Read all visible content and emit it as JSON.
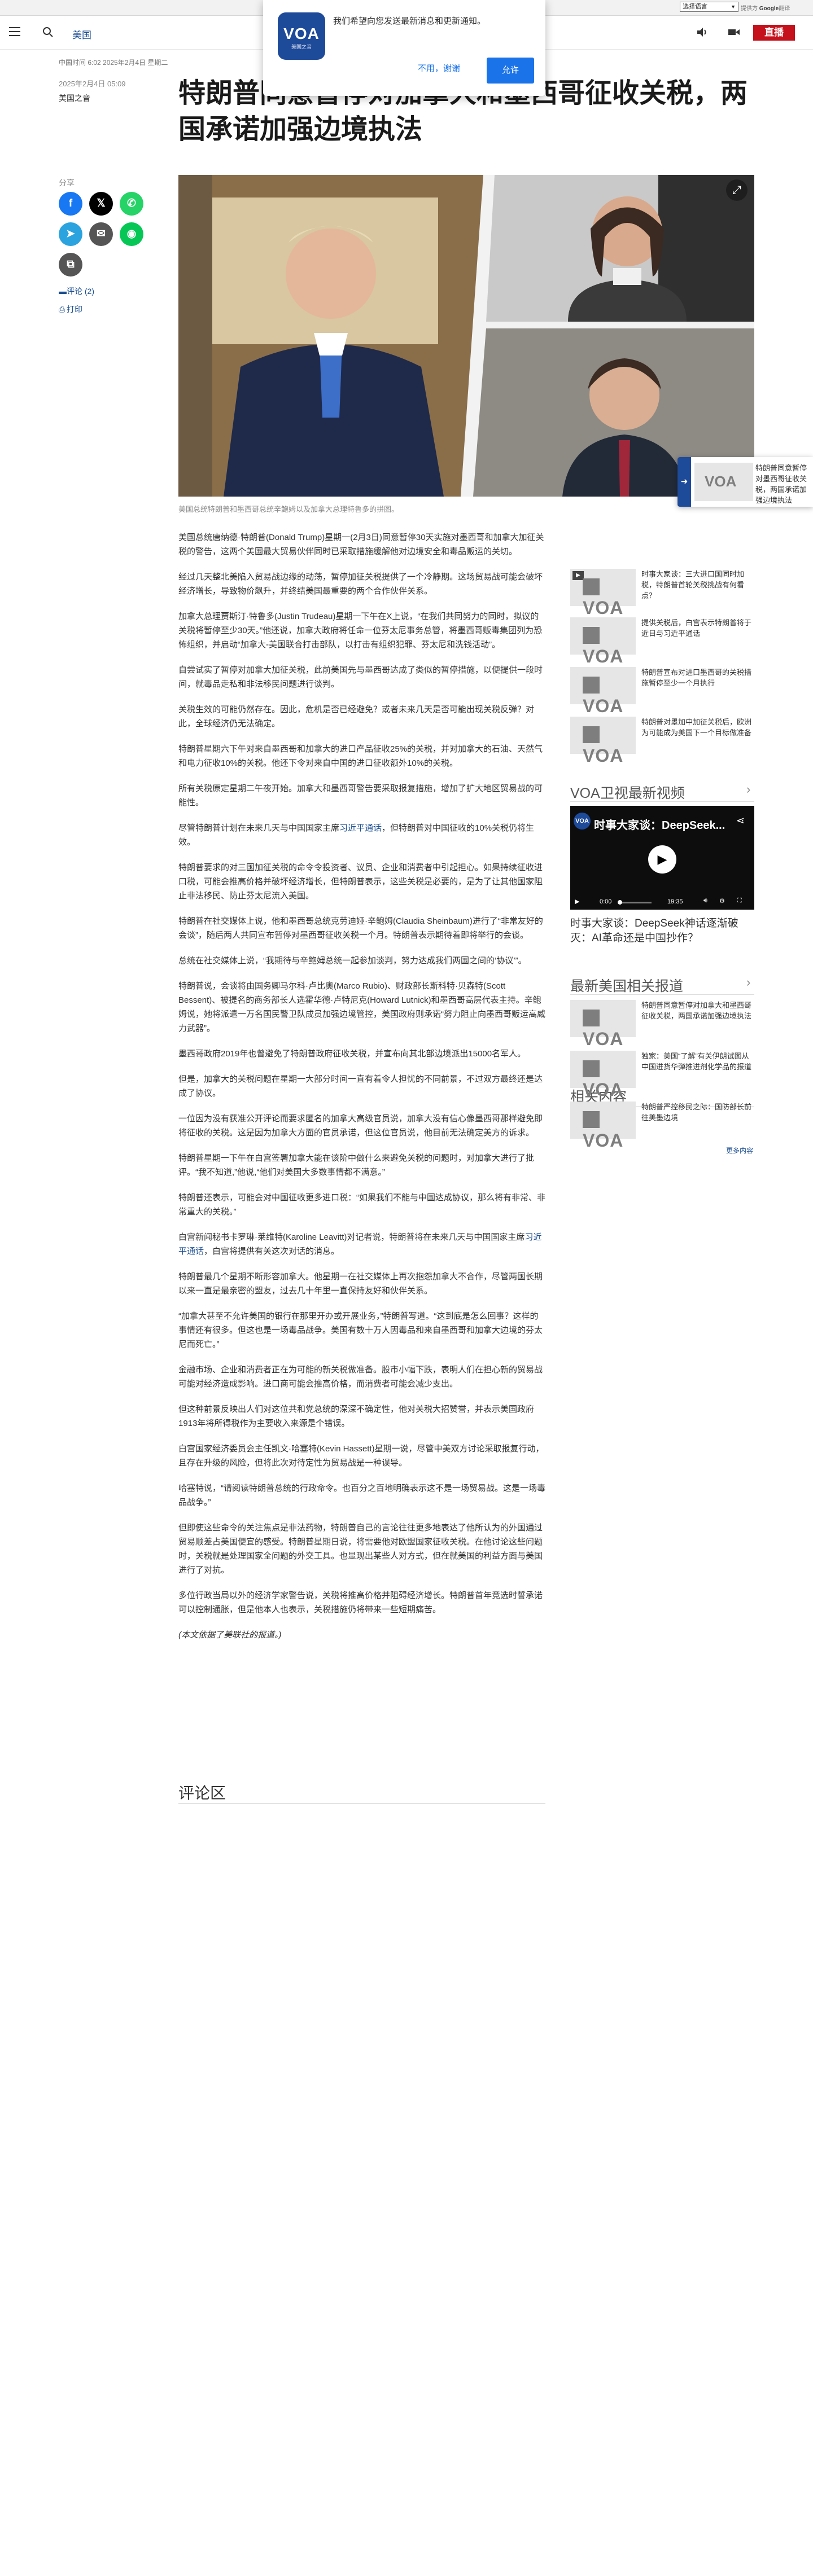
{
  "translate_bar": {
    "select_label": "选择语言",
    "powered_by_prefix": "提供方",
    "powered_by_brand": "Google",
    "powered_by_suffix": "翻译"
  },
  "header": {
    "section": "美国",
    "live_label": "直播"
  },
  "notification": {
    "logo_text": "VOA",
    "logo_sub": "美国之音",
    "message": "我们希望向您发送最新消息和更新通知。",
    "later_label": "不用，谢谢",
    "allow_label": "允许"
  },
  "meta": {
    "updated": "中国时间 6:02 2025年2月4日 星期二",
    "date": "2025年2月4日 05:09",
    "author": "美国之音"
  },
  "title": "特朗普同意暂停对加拿大和墨西哥征收关税，两国承诺加强边境执法",
  "share": {
    "label": "分享",
    "comments": "评论 (2)",
    "print": "打印"
  },
  "hero_caption": "美国总统特朗普和墨西哥总统辛鲍姆以及加拿大总理特鲁多的拼图。",
  "article": {
    "paragraphs": [
      "美国总统唐纳德·特朗普(Donald Trump)星期一(2月3日)同意暂停30天实施对墨西哥和加拿大加征关税的警告，这两个美国最大贸易伙伴同时已采取措施缓解他对边境安全和毒品贩运的关切。",
      "经过几天整北美陷入贸易战边缘的动荡，暂停加征关税提供了一个冷静期。这场贸易战可能会破坏经济增长，导致物价飙升，并终结美国最重要的两个合作伙伴关系。",
      "加拿大总理贾斯汀·特鲁多(Justin Trudeau)星期一下午在X上说，“在我们共同努力的同时，拟议的关税将暂停至少30天。”他还说，加拿大政府将任命一位芬太尼事务总管，将墨西哥贩毒集团列为恐怖组织，并启动“加拿大-美国联合打击部队，以打击有组织犯罪、芬太尼和洗钱活动”。",
      "自尝试实了暂停对加拿大加征关税，此前美国先与墨西哥达成了类似的暂停措施，以便提供一段时间，就毒品走私和非法移民问题进行谈判。",
      "关税生效的可能仍然存在。因此，危机是否已经避免？或者未来几天是否可能出现关税反弹？对此，全球经济仍无法确定。",
      "特朗普星期六下午对来自墨西哥和加拿大的进口产品征收25%的关税，并对加拿大的石油、天然气和电力征收10%的关税。他还下令对来自中国的进口征收额外10%的关税。",
      "所有关税原定星期二午夜开始。加拿大和墨西哥警告要采取报复措施，增加了扩大地区贸易战的可能性。",
      "尽管特朗普计划在未来几天与中国国家主席习近平通话，但特朗普对中国征收的10%关税仍将生效。",
      "特朗普要求的对三国加征关税的命令令投资者、议员、企业和消费者中引起担心。如果持续征收进口税，可能会推高价格并破坏经济增长，但特朗普表示，这些关税是必要的，是为了让其他国家阻止非法移民、防止芬太尼流入美国。",
      "特朗普在社交媒体上说，他和墨西哥总统克劳迪娅·辛鲍姆(Claudia Sheinbaum)进行了“非常友好的会谈”，随后两人共同宣布暂停对墨西哥征收关税一个月。特朗普表示期待着即将举行的会谈。",
      "总统在社交媒体上说，“我期待与辛鲍姆总统一起参加谈判，努力达成我们两国之间的‘协议’”。",
      "特朗普说，会谈将由国务卿马尔科·卢比奥(Marco Rubio)、财政部长斯科特·贝森特(Scott Bessent)、被提名的商务部长人选霍华德·卢特尼克(Howard Lutnick)和墨西哥高层代表主持。辛鲍姆说，她将派遣一万名国民警卫队成员加强边境管控，美国政府则承诺“努力阻止向墨西哥贩运高威力武器”。",
      "墨西哥政府2019年也曾避免了特朗普政府征收关税，并宣布向其北部边境派出15000名军人。",
      "但是，加拿大的关税问题在星期一大部分时间一直有着令人担忧的不同前景，不过双方最终还是达成了协议。",
      "一位因为没有获准公开评论而要求匿名的加拿大高级官员说，加拿大没有信心像墨西哥那样避免即将征收的关税。这是因为加拿大方面的官员承诺，但这位官员说，他目前无法确定美方的诉求。",
      "特朗普星期一下午在白宫签署加拿大能在该阶中做什么来避免关税的问题时，对加拿大进行了批评。“我不知道,”他说,“他们对美国大多数事情都不满意。”",
      "特朗普还表示，可能会对中国征收更多进口税：“如果我们不能与中国达成协议，那么将有非常、非常重大的关税。”",
      "白宫新闻秘书卡罗琳·莱维特(Karoline Leavitt)对记者说，特朗普将在未来几天与中国国家主席习近平通话，白宫将提供有关这次对话的消息。",
      "特朗普最几个星期不断形容加拿大。他星期一在社交媒体上再次抱怨加拿大不合作，尽管两国长期以来一直是最亲密的盟友，过去几十年里一直保持友好和伙伴关系。",
      "“加拿大甚至不允许美国的银行在那里开办或开展业务，”特朗普写道。“这到底是怎么回事？这样的事情还有很多。但这也是一场毒品战争。美国有数十万人因毒品和来自墨西哥和加拿大边境的芬太尼而死亡。”",
      "金融市场、企业和消费者正在为可能的新关税做准备。股市小幅下跌，表明人们在担心新的贸易战可能对经济造成影响。进口商可能会推高价格，而消费者可能会减少支出。",
      "但这种前景反映出人们对这位共和党总统的深深不确定性，他对关税大招赞誉，并表示美国政府1913年将所得税作为主要收入来源是个错误。",
      "白宫国家经济委员会主任凯文·哈塞特(Kevin Hassett)星期一说，尽管中美双方讨论采取报复行动，且存在升级的风险，但将此次对待定性为贸易战是一种误导。",
      "哈塞特说，“请阅读特朗普总统的行政命令。也百分之百地明确表示这不是一场贸易战。这是一场毒品战争。”",
      "但即使这些命令的关注焦点是非法药物，特朗普自己的言论往往更多地表达了他所认为的外国通过贸易顺差占美国便宜的感受。特朗普星期日说，将需要他对欧盟国家征收关税。在他讨论这些问题时，关税就是处理国家全问题的外交工具。也显现出某些人对方式，但在就美国的利益方面与美国进行了对抗。",
      "多位行政当局以外的经济学家警告说，关税将推高价格并阻碍经济增长。特朗普首年竞选时誓承诺可以控制通胀，但是他本人也表示，关税措施仍将带来一些短期痛苦。"
    ],
    "link_text": "习近平通话",
    "signoff": "(本文依据了美联社的报道。)"
  },
  "comments_heading": "评论区",
  "related": {
    "heading": "相关内容",
    "items": [
      "时事大家谈：三大进口国同时加税，特朗普首轮关税挑战有何看点？",
      "提供关税后，白宫表示特朗普将于近日与习近平通话",
      "特朗普宣布对进口墨西哥的关税措施暂停至少一个月执行",
      "特朗普对墨加中加征关税后，欧洲为可能成为美国下一个目标做准备"
    ]
  },
  "video": {
    "heading": "VOA卫视最新视频",
    "title": "时事大家谈：DeepSeek...",
    "time_current": "0:00",
    "time_total": "19:35",
    "caption": "时事大家谈：DeepSeek神话逐渐破灭：AI革命还是中国抄作？"
  },
  "latest": {
    "heading": "最新美国相关报道",
    "items": [
      "特朗普同意暂停对加拿大和墨西哥征收关税，两国承诺加强边境执法",
      "独家：美国“了解”有关伊朗试图从中国进货华弹推进剂化学品的报道",
      "特朗普严控移民之际：国防部长前往美墨边境"
    ],
    "more": "更多内容"
  },
  "floating": {
    "text": "特朗普同意暂停对墨西哥征收关税，两国承诺加强边境执法"
  },
  "colors": {
    "brand": "#1e4a9a",
    "live": "#c4111b",
    "link": "#1d4f91"
  }
}
